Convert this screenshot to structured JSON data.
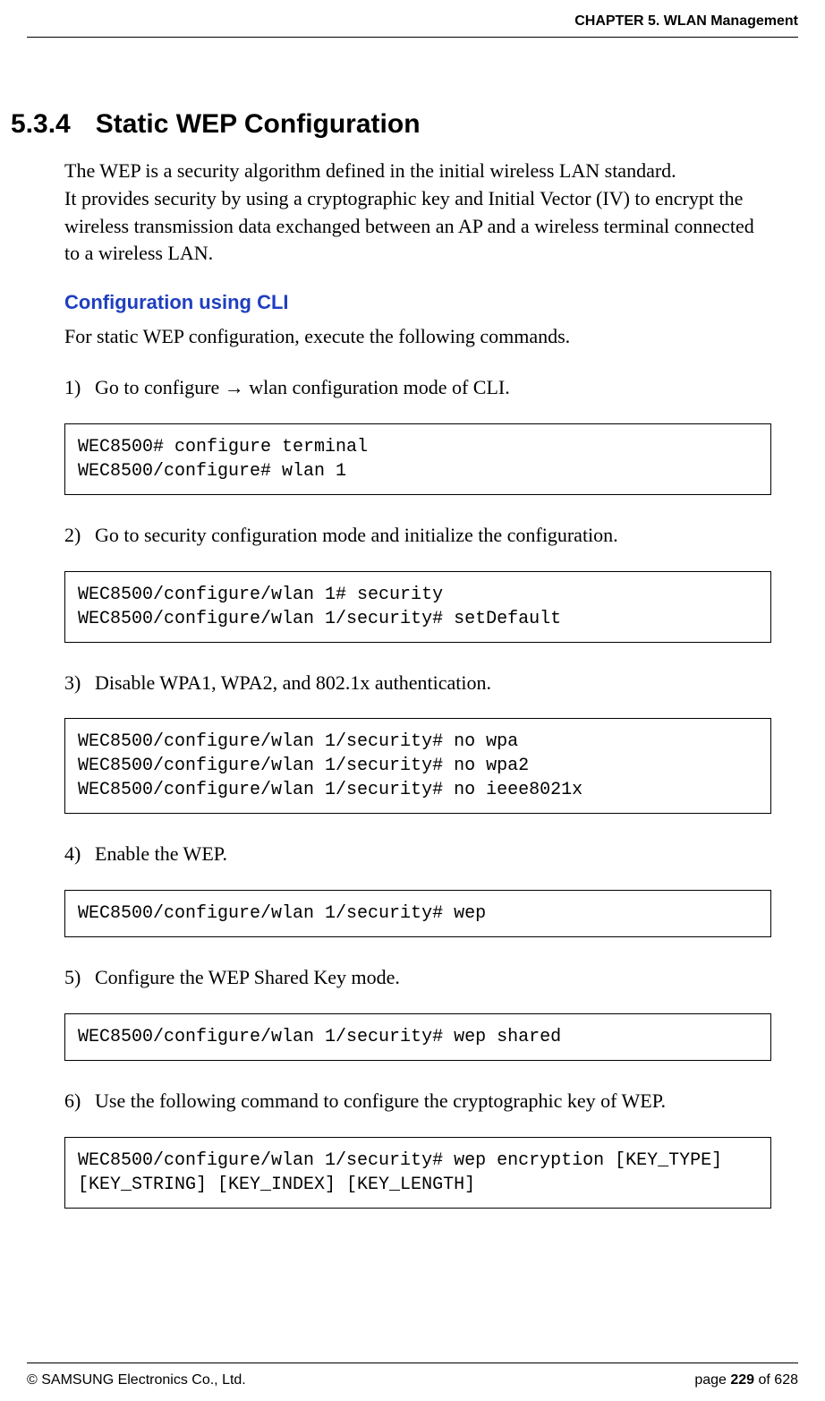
{
  "header": {
    "chapter": "CHAPTER 5. WLAN Management"
  },
  "section": {
    "number": "5.3.4",
    "title": "Static WEP Configuration",
    "intro": "The WEP is a security algorithm defined in the initial wireless LAN standard.\nIt provides security by using a cryptographic key and Initial Vector (IV) to encrypt the wireless transmission data exchanged between an AP and a wireless terminal connected to a wireless LAN."
  },
  "subsection": {
    "title": "Configuration using CLI",
    "intro": "For static WEP configuration, execute the following commands."
  },
  "steps": [
    {
      "num": "1)",
      "text": "Go to configure → wlan configuration mode of CLI.",
      "code": "WEC8500# configure terminal\nWEC8500/configure# wlan 1"
    },
    {
      "num": "2)",
      "text": "Go to security configuration mode and initialize the configuration.",
      "code": "WEC8500/configure/wlan 1# security\nWEC8500/configure/wlan 1/security# setDefault"
    },
    {
      "num": "3)",
      "text": "Disable WPA1, WPA2, and 802.1x authentication.",
      "code": "WEC8500/configure/wlan 1/security# no wpa\nWEC8500/configure/wlan 1/security# no wpa2\nWEC8500/configure/wlan 1/security# no ieee8021x"
    },
    {
      "num": "4)",
      "text": "Enable the WEP.",
      "code": "WEC8500/configure/wlan 1/security# wep"
    },
    {
      "num": "5)",
      "text": "Configure the WEP Shared Key mode.",
      "code": "WEC8500/configure/wlan 1/security# wep shared"
    },
    {
      "num": "6)",
      "text": "Use the following command to configure the cryptographic key of WEP.",
      "code": "WEC8500/configure/wlan 1/security# wep encryption [KEY_TYPE] [KEY_STRING] [KEY_INDEX] [KEY_LENGTH]"
    }
  ],
  "footer": {
    "left": "© SAMSUNG Electronics Co., Ltd.",
    "right_prefix": "page ",
    "page_current": "229",
    "page_of": " of 628"
  }
}
